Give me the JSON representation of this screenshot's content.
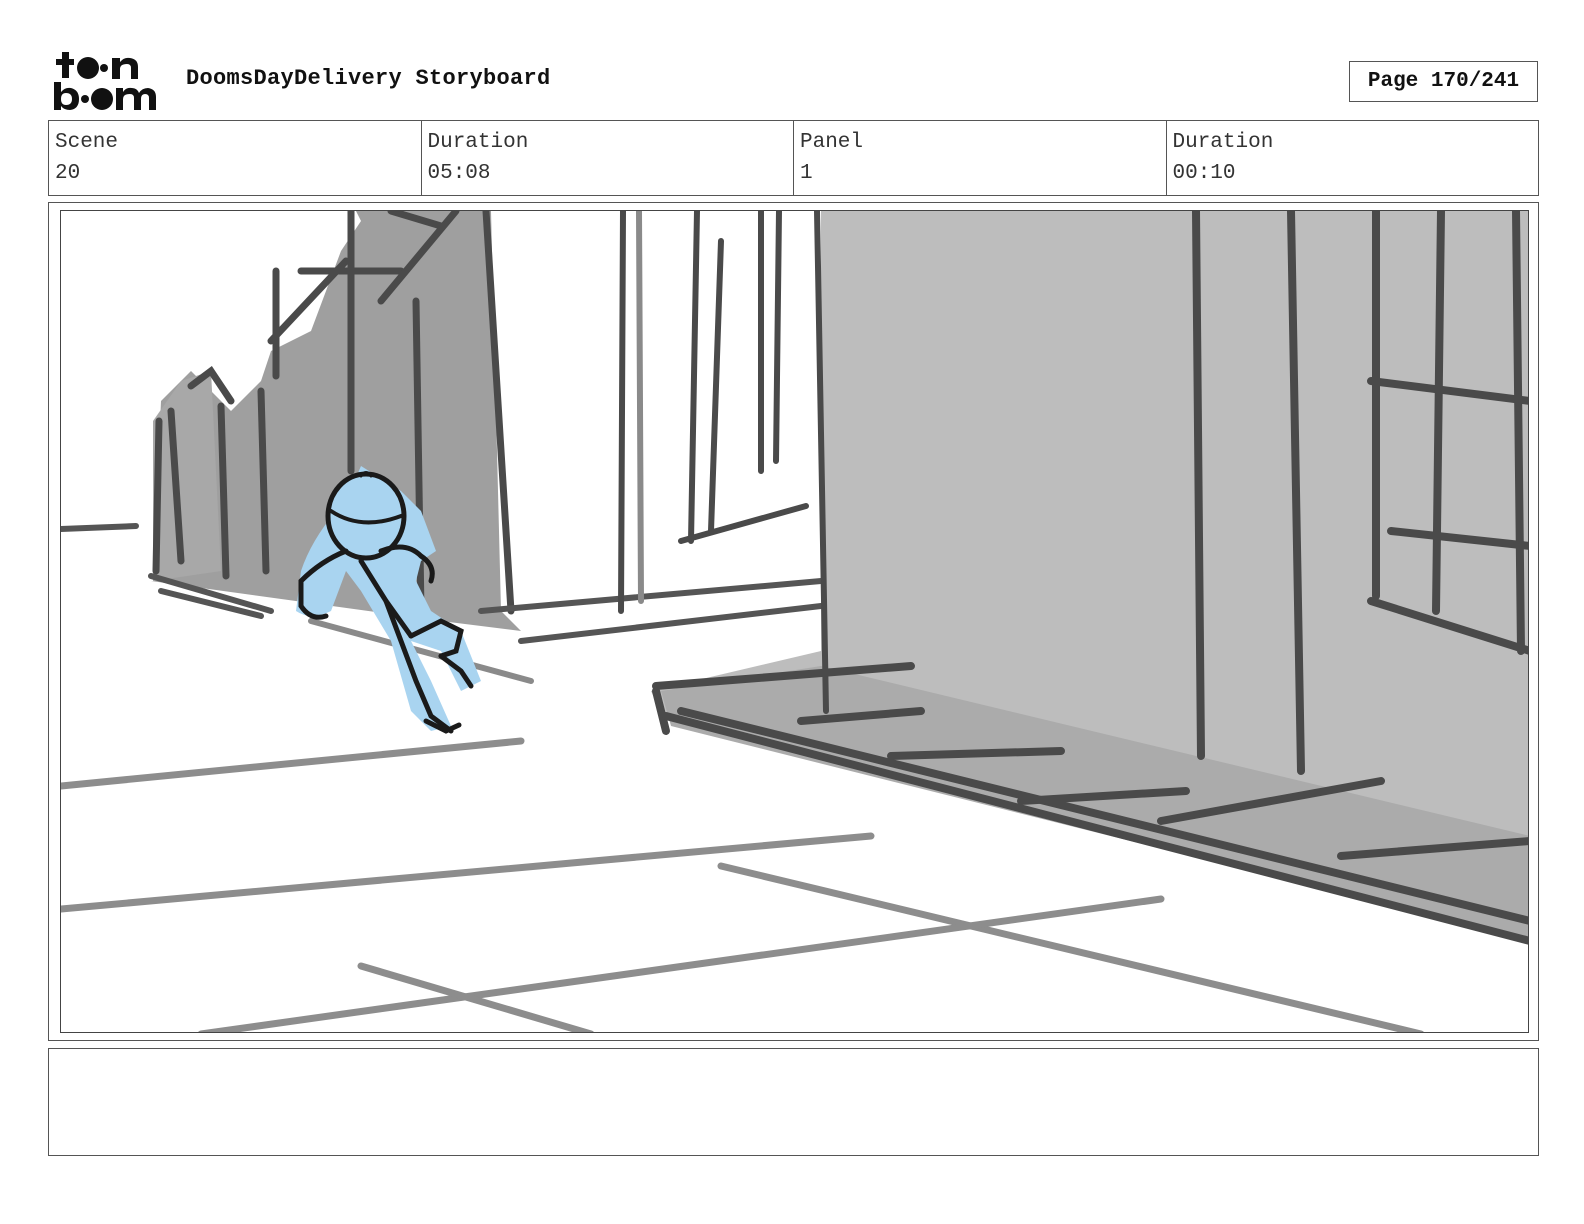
{
  "header": {
    "logo_text": "toon boom",
    "title": "DoomsDayDelivery Storyboard",
    "page_label": "Page 170/241"
  },
  "info": {
    "scene_label": "Scene",
    "scene_value": "20",
    "scene_duration_label": "Duration",
    "scene_duration_value": "05:08",
    "panel_label": "Panel",
    "panel_value": "1",
    "panel_duration_label": "Duration",
    "panel_duration_value": "00:10"
  },
  "panel": {
    "colors": {
      "building_gray": "#bdbdbd",
      "dark_gray": "#9e9e9e",
      "stroke": "#555555",
      "character_fill": "#a9d4f0",
      "character_line": "#1a1a1a"
    }
  },
  "notes": {
    "text": ""
  }
}
